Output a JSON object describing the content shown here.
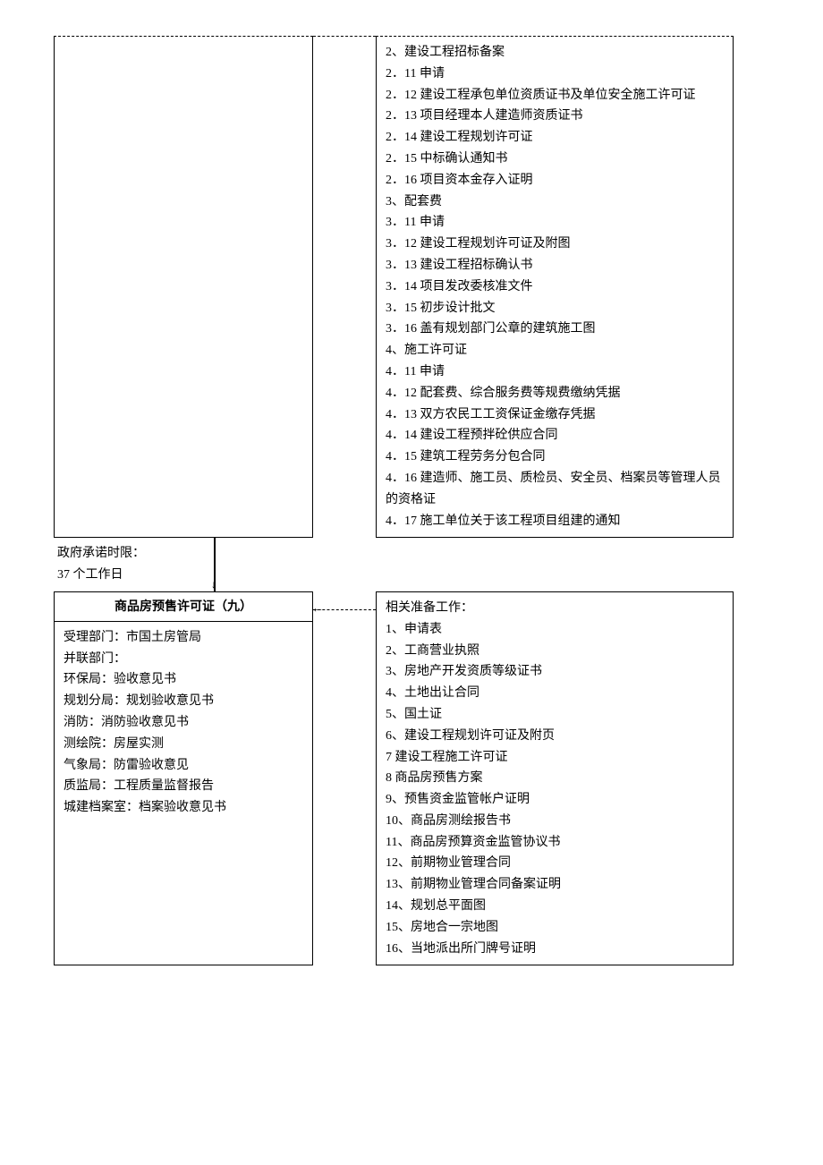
{
  "topRow": {
    "left_blank": "",
    "right_lines": [
      "2、建设工程招标备案",
      "2．11 申请",
      "2．12 建设工程承包单位资质证书及单位安全施工许可证",
      "2．13 项目经理本人建造师资质证书",
      "2．14 建设工程规划许可证",
      "2．15 中标确认通知书",
      "2．16 项目资本金存入证明",
      "3、配套费",
      "3．11 申请",
      "3．12 建设工程规划许可证及附图",
      "3．13 建设工程招标确认书",
      "3．14 项目发改委核准文件",
      "3．15 初步设计批文",
      "3．16 盖有规划部门公章的建筑施工图",
      "4、施工许可证",
      "4．11 申请",
      "4．12 配套费、综合服务费等规费缴纳凭据",
      "4．13 双方农民工工资保证金缴存凭据",
      "4．14 建设工程预拌砼供应合同",
      "4．15 建筑工程劳务分包合同",
      "4．16 建造师、施工员、质检员、安全员、档案员等管理人员的资格证",
      "4．17 施工单位关于该工程项目组建的通知"
    ]
  },
  "timing": {
    "label": "政府承诺时限：",
    "value": "37 个工作日"
  },
  "bottomRow": {
    "left_title": "商品房预售许可证（九）",
    "left_lines": [
      "受理部门：市国土房管局",
      "并联部门：",
      "环保局：验收意见书",
      "规划分局：规划验收意见书",
      "消防：消防验收意见书",
      "测绘院：房屋实测",
      "气象局：防雷验收意见",
      "质监局：工程质量监督报告",
      "城建档案室：档案验收意见书"
    ],
    "right_lines": [
      "相关准备工作：",
      "1、申请表",
      "2、工商营业执照",
      "3、房地产开发资质等级证书",
      "4、土地出让合同",
      "5、国土证",
      "6、建设工程规划许可证及附页",
      "7 建设工程施工许可证",
      "8 商品房预售方案",
      "9、预售资金监管帐户证明",
      "10、商品房测绘报告书",
      "11、商品房预算资金监管协议书",
      "12、前期物业管理合同",
      "13、前期物业管理合同备案证明",
      "14、规划总平面图",
      "15、房地合一宗地图",
      "16、当地派出所门牌号证明"
    ]
  },
  "arrows": {
    "left_arrow": "←",
    "down_arrow": "↓"
  }
}
